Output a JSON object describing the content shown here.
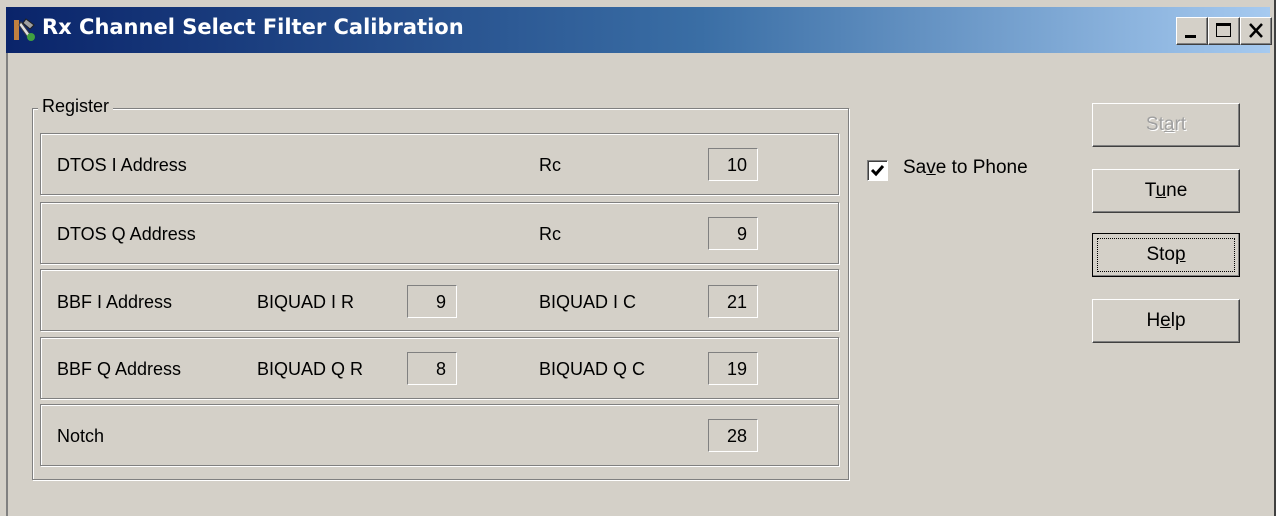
{
  "window": {
    "title": "Rx Channel Select Filter Calibration",
    "caption_buttons": [
      "minimize",
      "maximize",
      "close"
    ]
  },
  "register": {
    "label": "Register",
    "rows": [
      {
        "label": "DTOS I Address",
        "mid_label": "",
        "mid_value": "",
        "right_label": "Rc",
        "right_value": "10"
      },
      {
        "label": "DTOS Q Address",
        "mid_label": "",
        "mid_value": "",
        "right_label": "Rc",
        "right_value": "9"
      },
      {
        "label": "BBF I Address",
        "mid_label": "BIQUAD I R",
        "mid_value": "9",
        "right_label": "BIQUAD I C",
        "right_value": "21"
      },
      {
        "label": "BBF Q Address",
        "mid_label": "BIQUAD Q R",
        "mid_value": "8",
        "right_label": "BIQUAD Q C",
        "right_value": "19"
      },
      {
        "label": "Notch",
        "mid_label": "",
        "mid_value": "",
        "right_label": "",
        "right_value": "28"
      }
    ]
  },
  "save_to_phone": {
    "checked": true,
    "label_pre": "Sa",
    "label_accel": "v",
    "label_post": "e to Phone"
  },
  "buttons": {
    "start": {
      "pre": "St",
      "accel": "a",
      "post": "rt",
      "enabled": false
    },
    "tune": {
      "pre": "T",
      "accel": "u",
      "post": "ne",
      "enabled": true
    },
    "stop": {
      "pre": "Sto",
      "accel": "p",
      "post": "",
      "enabled": true,
      "focused": true
    },
    "help": {
      "pre": "H",
      "accel": "e",
      "post": "lp",
      "enabled": true
    }
  }
}
